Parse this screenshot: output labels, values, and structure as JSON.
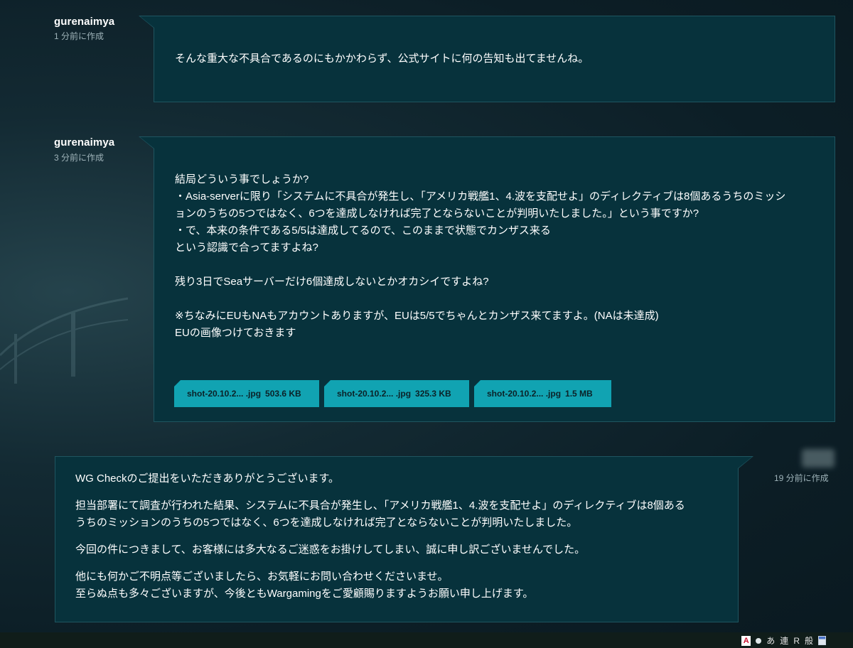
{
  "thread": {
    "messages": [
      {
        "author": "gurenaimya",
        "time": "1 分前に作成",
        "lines": [
          "そんな重大な不具合であるのにもかかわらず、公式サイトに何の告知も出てませんね。"
        ]
      },
      {
        "author": "gurenaimya",
        "time": "3 分前に作成",
        "lines": [
          "結局どういう事でしょうか?",
          "・Asia-serverに限り「システムに不具合が発生し、「アメリカ戦艦1、4.波を支配せよ」のディレクティブは8個あるうちのミッシ",
          "ョンのうちの5つではなく、6つを達成しなければ完了とならないことが判明いたしました。」という事ですか?",
          "・で、本来の条件である5/5は達成してるので、このままで状態でカンザス来る",
          "という認識で合ってますよね?",
          "",
          "残り3日でSeaサーバーだけ6個達成しないとかオカシイですよね?",
          "",
          "※ちなみにEUもNAもアカウントありますが、EUは5/5でちゃんとカンザス来てますよ。(NAは未達成)",
          "EUの画像つけておきます"
        ],
        "attachments": [
          {
            "name": "shot-20.10.2... .jpg",
            "size": "503.6 KB"
          },
          {
            "name": "shot-20.10.2... .jpg",
            "size": "325.3 KB"
          },
          {
            "name": "shot-20.10.2... .jpg",
            "size": "1.5 MB"
          }
        ]
      },
      {
        "author": "",
        "time": "19 分前に作成",
        "lines": [
          "WG Checkのご提出をいただきありがとうございます。",
          "担当部署にて調査が行われた結果、システムに不具合が発生し、「アメリカ戦艦1、4.波を支配せよ」のディレクティブは8個ある",
          "うちのミッションのうちの5つではなく、6つを達成しなければ完了とならないことが判明いたしました。",
          "今回の件につきまして、お客様には多大なるご迷惑をお掛けしてしまい、誠に申し訳ございませんでした。",
          "他にも何かご不明点等ございましたら、お気軽にお問い合わせくださいませ。",
          "至らぬ点も多々ございますが、今後ともWargamingをご愛顧賜りますようお願い申し上げます。"
        ]
      }
    ]
  },
  "taskbar": {
    "tray_items": [
      "あ",
      "連",
      "R",
      "般"
    ],
    "icons": [
      "acrobat-icon",
      "status-dot-icon",
      "ime-pad-icon"
    ]
  }
}
